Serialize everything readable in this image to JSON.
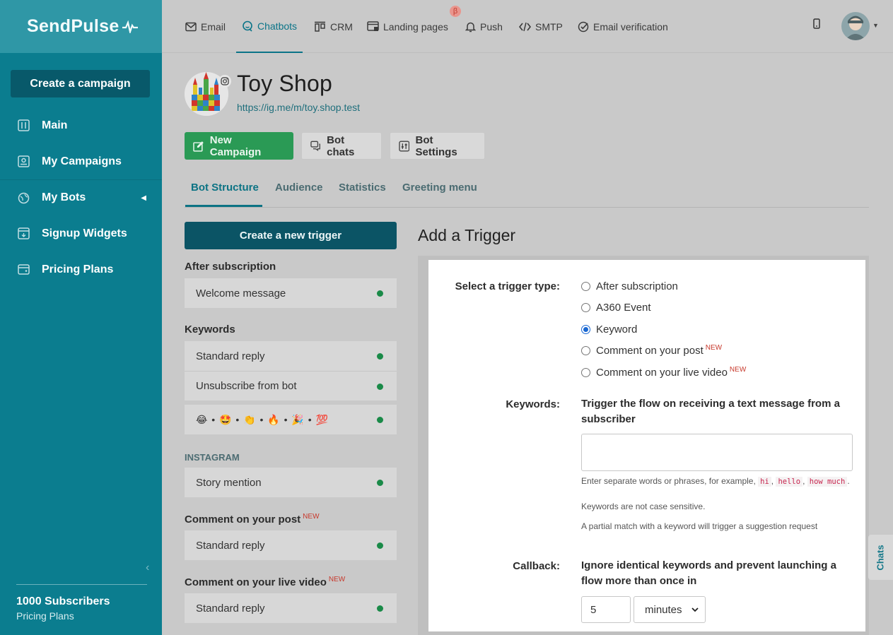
{
  "sidebar": {
    "logo": "SendPulse",
    "create_button": "Create a campaign",
    "items": [
      {
        "label": "Main",
        "icon": "sliders-icon"
      },
      {
        "label": "My Campaigns",
        "icon": "campaigns-icon"
      },
      {
        "label": "My Bots",
        "icon": "globe-icon"
      },
      {
        "label": "Signup Widgets",
        "icon": "widget-icon"
      },
      {
        "label": "Pricing Plans",
        "icon": "wallet-icon"
      }
    ],
    "subscribers": "1000 Subscribers",
    "plan_link": "Pricing Plans"
  },
  "topnav": {
    "items": [
      {
        "label": "Email",
        "icon": "envelope-icon"
      },
      {
        "label": "Chatbots",
        "icon": "chat-icon"
      },
      {
        "label": "CRM",
        "icon": "crm-icon"
      },
      {
        "label": "Landing pages",
        "icon": "landing-icon"
      },
      {
        "label": "Push",
        "icon": "bell-icon"
      },
      {
        "label": "SMTP",
        "icon": "code-icon"
      },
      {
        "label": "Email verification",
        "icon": "check-circle-icon"
      }
    ],
    "beta_badge": "β"
  },
  "bot": {
    "title": "Toy Shop",
    "link": "https://ig.me/m/toy.shop.test"
  },
  "actions": {
    "new_campaign": "New Campaign",
    "bot_chats": "Bot chats",
    "bot_settings": "Bot Settings"
  },
  "tabs": [
    "Bot Structure",
    "Audience",
    "Statistics",
    "Greeting menu"
  ],
  "triggers": {
    "create_button": "Create a new trigger",
    "after_subscription_label": "After subscription",
    "welcome": "Welcome message",
    "keywords_label": "Keywords",
    "standard_reply": "Standard reply",
    "unsubscribe": "Unsubscribe from bot",
    "emoji_row": "😂 • 🤩 • 👏 • 🔥 • 🎉 • 💯",
    "instagram_label": "INSTAGRAM",
    "story_mention": "Story mention",
    "comment_post_label": "Comment on your post",
    "comment_live_label": "Comment on your live video",
    "new_tag": "NEW"
  },
  "panel": {
    "title": "Add a Trigger",
    "trigger_type_label": "Select a trigger type:",
    "options": [
      "After subscription",
      "A360 Event",
      "Keyword",
      "Comment on your post",
      "Comment on your live video"
    ],
    "selected": "Keyword",
    "new_tag": "NEW",
    "keywords_label": "Keywords:",
    "keywords_desc": "Trigger the flow on receiving a text message from a subscriber",
    "keywords_value": "",
    "hint_prefix": "Enter separate words or phrases, for example,",
    "hint_examples": [
      "hi",
      "hello",
      "how much"
    ],
    "hint_case": "Keywords are not case sensitive.",
    "hint_partial": "A partial match with a keyword will trigger a suggestion request",
    "callback_label": "Callback:",
    "callback_desc": "Ignore identical keywords and prevent launching a flow more than once in",
    "callback_value": "5",
    "callback_unit": "minutes"
  },
  "chats_tab": "Chats"
}
